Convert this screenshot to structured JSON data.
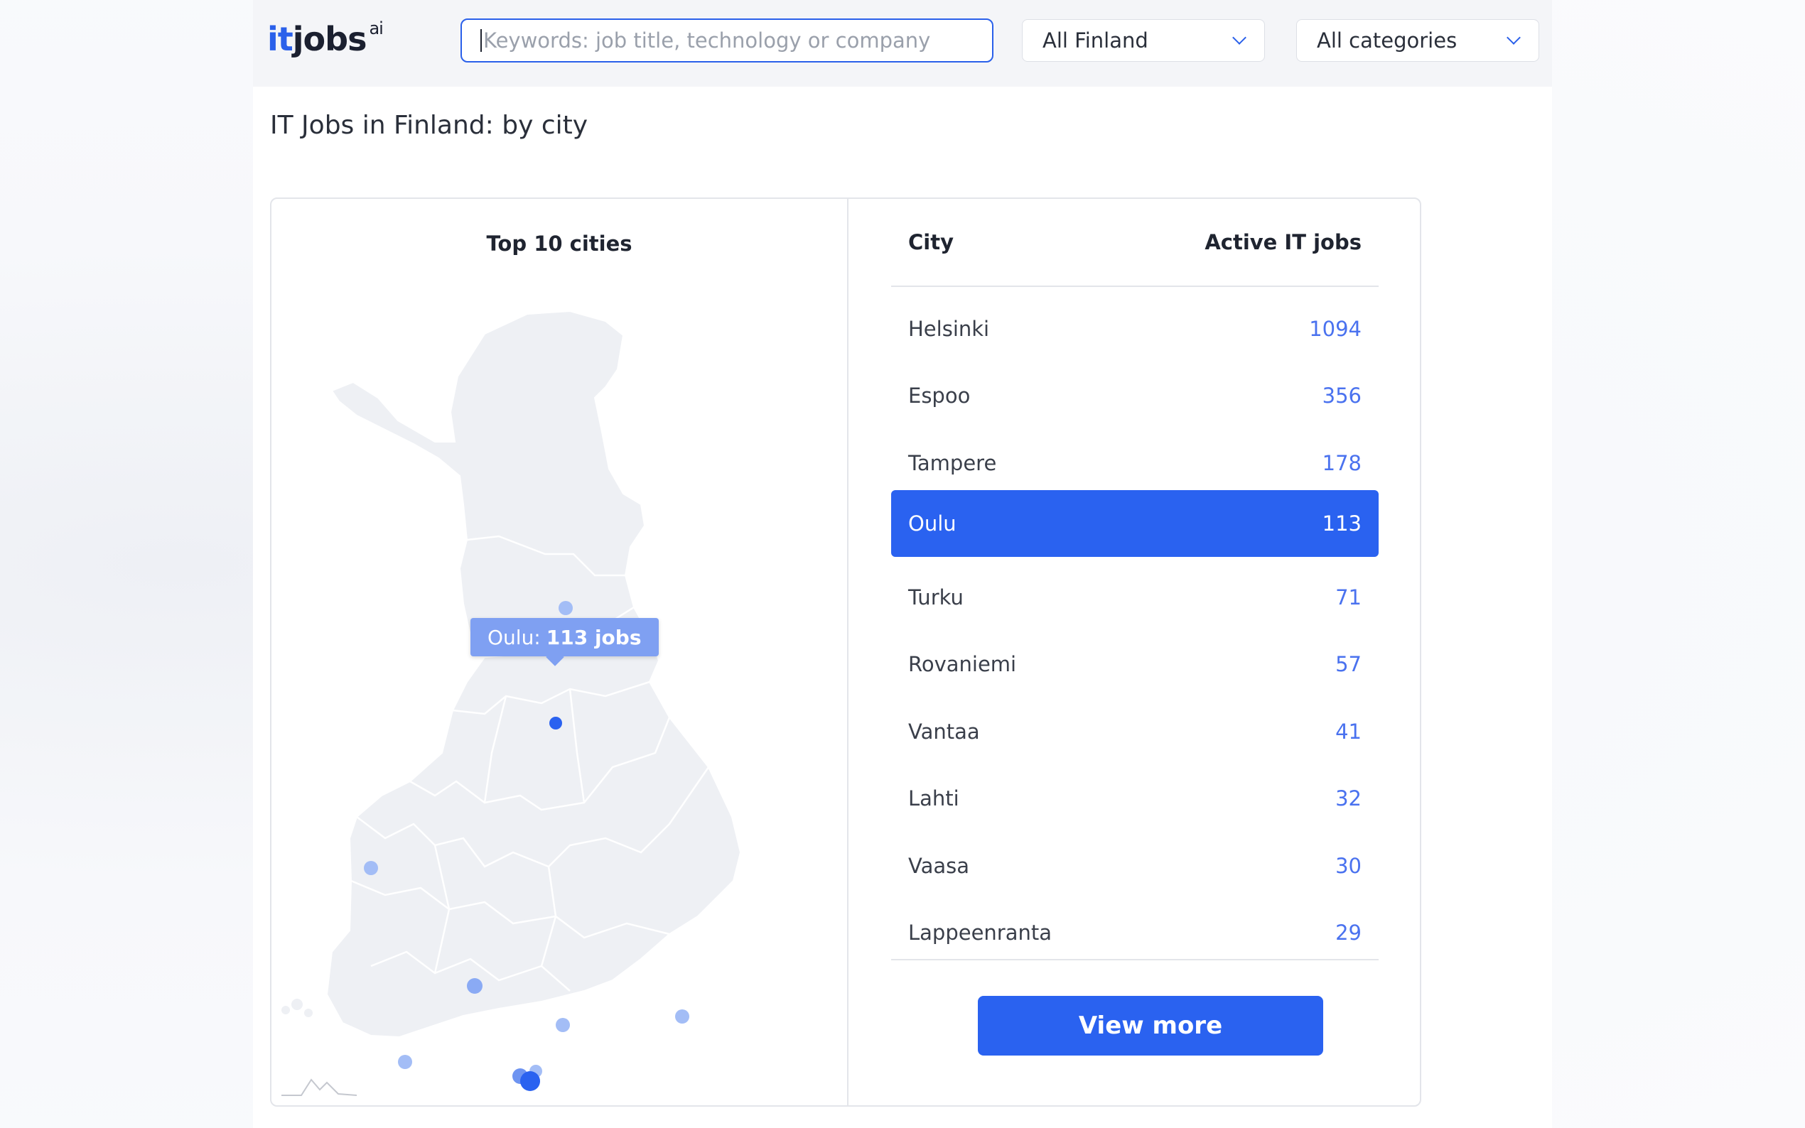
{
  "header": {
    "logo_it": "it",
    "logo_jobs": "jobs",
    "logo_suffix": "ai",
    "search_placeholder": "Keywords: job title, technology or company",
    "location_select": "All Finland",
    "category_select": "All categories"
  },
  "page_title": "IT Jobs in Finland: by city",
  "map": {
    "title": "Top 10 cities",
    "tooltip_city": "Oulu:",
    "tooltip_jobs": "113 jobs",
    "marker_color": "#7fa0f2",
    "active_marker_color": "#2a62f0"
  },
  "table": {
    "col_city": "City",
    "col_jobs": "Active IT jobs",
    "rows": [
      {
        "city": "Helsinki",
        "jobs": "1094"
      },
      {
        "city": "Espoo",
        "jobs": "356"
      },
      {
        "city": "Tampere",
        "jobs": "178"
      },
      {
        "city": "Oulu",
        "jobs": "113"
      },
      {
        "city": "Turku",
        "jobs": "71"
      },
      {
        "city": "Rovaniemi",
        "jobs": "57"
      },
      {
        "city": "Vantaa",
        "jobs": "41"
      },
      {
        "city": "Lahti",
        "jobs": "32"
      },
      {
        "city": "Vaasa",
        "jobs": "30"
      },
      {
        "city": "Lappeenranta",
        "jobs": "29"
      }
    ],
    "active_city": "Oulu"
  },
  "view_more_label": "View more",
  "colors": {
    "accent": "#2a62f0",
    "number_text": "#4a72ef"
  }
}
